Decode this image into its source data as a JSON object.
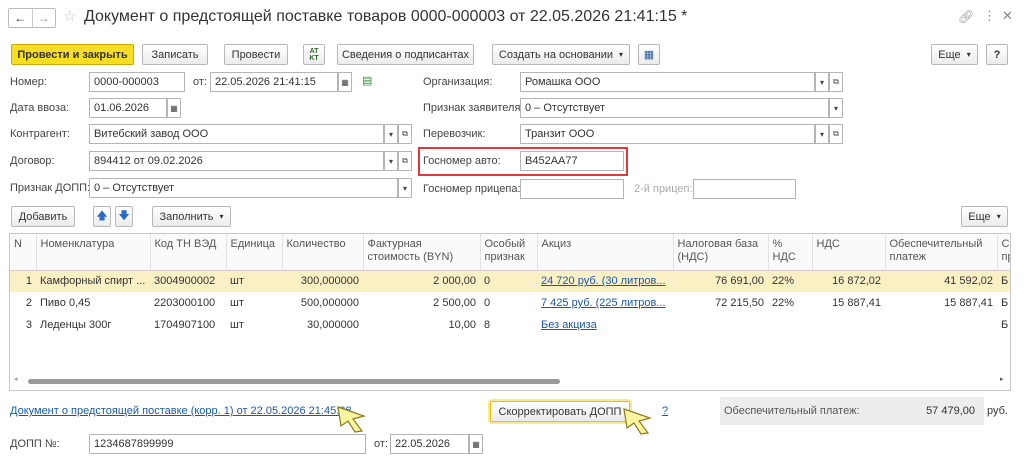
{
  "window": {
    "title": "Документ о предстоящей поставке товаров 0000-000003 от 22.05.2026 21:41:15 *"
  },
  "toolbar": {
    "post_close": "Провести и закрыть",
    "write": "Записать",
    "post": "Провести",
    "signers": "Сведения о подписантах",
    "create_based": "Создать на основании",
    "more": "Еще",
    "help": "?"
  },
  "form": {
    "number_label": "Номер:",
    "number_value": "0000-000003",
    "from_label": "от:",
    "from_value": "22.05.2026 21:41:15",
    "import_date_label": "Дата ввоза:",
    "import_date_value": "01.06.2026",
    "contractor_label": "Контрагент:",
    "contractor_value": "Витебский завод ООО",
    "contract_label": "Договор:",
    "contract_value": "894412 от 09.02.2026",
    "dopp_sign_label": "Признак ДОПП:",
    "dopp_sign_value": "0 – Отсутствует",
    "org_label": "Организация:",
    "org_value": "Ромашка ООО",
    "applicant_label": "Признак заявителя:",
    "applicant_value": "0 – Отсутствует",
    "carrier_label": "Перевозчик:",
    "carrier_value": "Транзит ООО",
    "plate_label": "Госномер авто:",
    "plate_value": "В452АА77",
    "trailer_label": "Госномер прицепа:",
    "trailer_value": "",
    "trailer2_label": "2-й прицеп:",
    "trailer2_value": ""
  },
  "table_toolbar": {
    "add": "Добавить",
    "fill": "Заполнить",
    "more": "Еще"
  },
  "table": {
    "headers": [
      "N",
      "Номенклатура",
      "Код ТН ВЭД",
      "Единица",
      "Количество",
      "Фактурная стоимость (BYN)",
      "Особый признак",
      "Акциз",
      "Налоговая база (НДС)",
      "% НДС",
      "НДС",
      "Обеспечительный платеж",
      "С пр"
    ],
    "rows": [
      [
        "1",
        "Камфорный спирт ...",
        "3004900002",
        "шт",
        "300,000000",
        "2 000,00",
        "0",
        "24 720 руб. (30 литров...",
        "76 691,00",
        "22%",
        "16 872,02",
        "41 592,02",
        "Б"
      ],
      [
        "2",
        "Пиво 0,45",
        "2203000100",
        "шт",
        "500,000000",
        "2 500,00",
        "0",
        "7 425 руб. (225 литров...",
        "72 215,50",
        "22%",
        "15 887,41",
        "15 887,41",
        "Б"
      ],
      [
        "3",
        "Леденцы 300г",
        "1704907100",
        "шт",
        "30,000000",
        "10,00",
        "8",
        "Без акциза",
        "",
        "",
        "",
        "",
        "Б"
      ]
    ]
  },
  "footer": {
    "correction_link": "Документ о предстоящей поставке (корр. 1) от 22.05.2026 21:45:38",
    "correct_button": "Скорректировать ДОПП",
    "help_mark": "?",
    "guarantee_label": "Обеспечительный платеж:",
    "guarantee_value": "57 479,00",
    "currency": "руб.",
    "dopp_num_label": "ДОПП №:",
    "dopp_num_value": "1234687899999",
    "dopp_from_label": "от:",
    "dopp_from_value": "22.05.2026"
  },
  "colors": {
    "accent": "#f8dd25",
    "selected_row": "#fbefc4",
    "link": "#1a58a6",
    "highlight_border": "#e03a3a"
  }
}
